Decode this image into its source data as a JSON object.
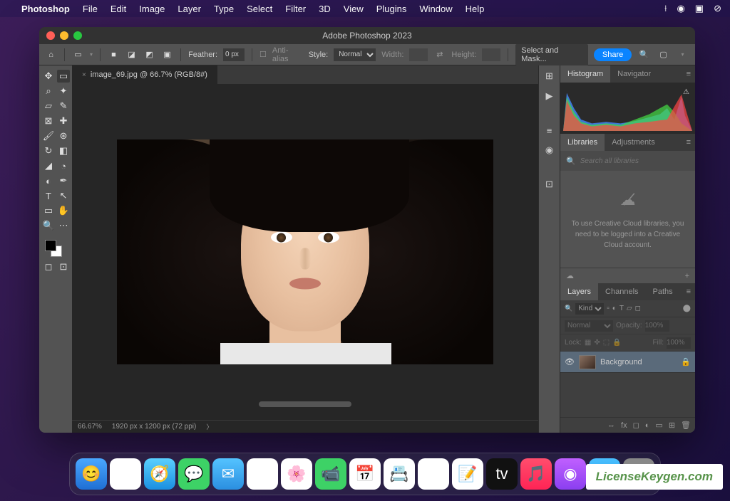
{
  "menubar": {
    "app": "Photoshop",
    "items": [
      "File",
      "Edit",
      "Image",
      "Layer",
      "Type",
      "Select",
      "Filter",
      "3D",
      "View",
      "Plugins",
      "Window",
      "Help"
    ]
  },
  "window": {
    "title": "Adobe Photoshop 2023"
  },
  "optionsbar": {
    "feather_label": "Feather:",
    "feather_value": "0 px",
    "antialias": "Anti-alias",
    "style_label": "Style:",
    "style_value": "Normal",
    "width_label": "Width:",
    "height_label": "Height:",
    "select_mask": "Select and Mask...",
    "share": "Share"
  },
  "document": {
    "tab": "image_69.jpg @ 66.7% (RGB/8#)",
    "zoom": "66.67%",
    "info": "1920 px x 1200 px (72 ppi)"
  },
  "panels": {
    "histogram_tab": "Histogram",
    "navigator_tab": "Navigator",
    "libraries_tab": "Libraries",
    "adjustments_tab": "Adjustments",
    "search_placeholder": "Search all libraries",
    "cc_message": "To use Creative Cloud libraries, you need to be logged into a Creative Cloud account.",
    "layers_tab": "Layers",
    "channels_tab": "Channels",
    "paths_tab": "Paths",
    "kind": "Kind",
    "blend": "Normal",
    "opacity_label": "Opacity:",
    "opacity_value": "100%",
    "lock_label": "Lock:",
    "fill_label": "Fill:",
    "fill_value": "100%",
    "layer_name": "Background"
  },
  "watermark": "LicenseKeygen.com"
}
